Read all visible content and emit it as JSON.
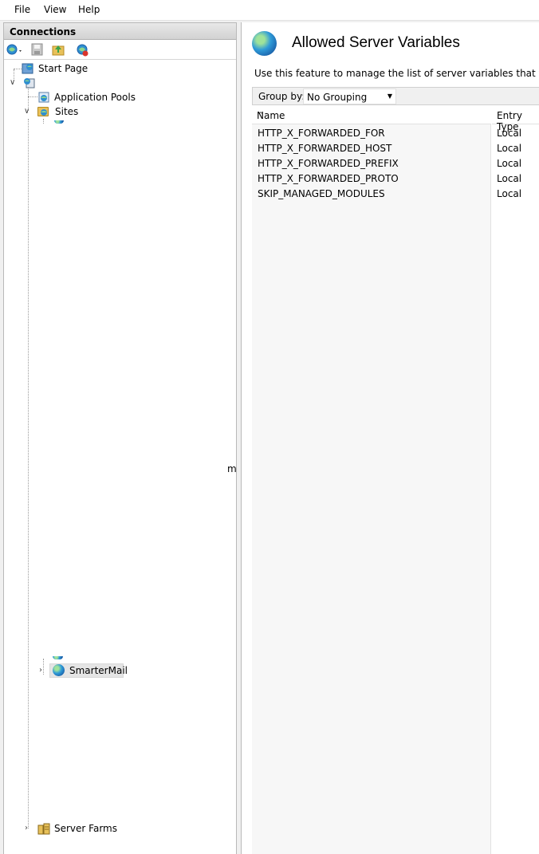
{
  "menu": {
    "file": "File",
    "view": "View",
    "help": "Help"
  },
  "connections": {
    "title": "Connections",
    "tree": {
      "start_page": "Start Page",
      "app_pools": "Application Pools",
      "sites": "Sites",
      "smartermail": "SmarterMail",
      "server_farms": "Server Farms",
      "partial_fragment": "m"
    }
  },
  "feature": {
    "title": "Allowed Server Variables",
    "description": "Use this feature to manage the list of server variables that you can se",
    "group_by_label": "Group by:",
    "group_by_value": "No Grouping"
  },
  "grid": {
    "columns": {
      "name": "Name",
      "entry_type": "Entry Type"
    },
    "rows": [
      {
        "name": "HTTP_X_FORWARDED_FOR",
        "entry_type": "Local"
      },
      {
        "name": "HTTP_X_FORWARDED_HOST",
        "entry_type": "Local"
      },
      {
        "name": "HTTP_X_FORWARDED_PREFIX",
        "entry_type": "Local"
      },
      {
        "name": "HTTP_X_FORWARDED_PROTO",
        "entry_type": "Local"
      },
      {
        "name": "SKIP_MANAGED_MODULES",
        "entry_type": "Local"
      }
    ]
  },
  "icons": {
    "globe": "globe-icon",
    "folder": "folder-icon",
    "save": "save-icon",
    "server": "server-icon"
  }
}
